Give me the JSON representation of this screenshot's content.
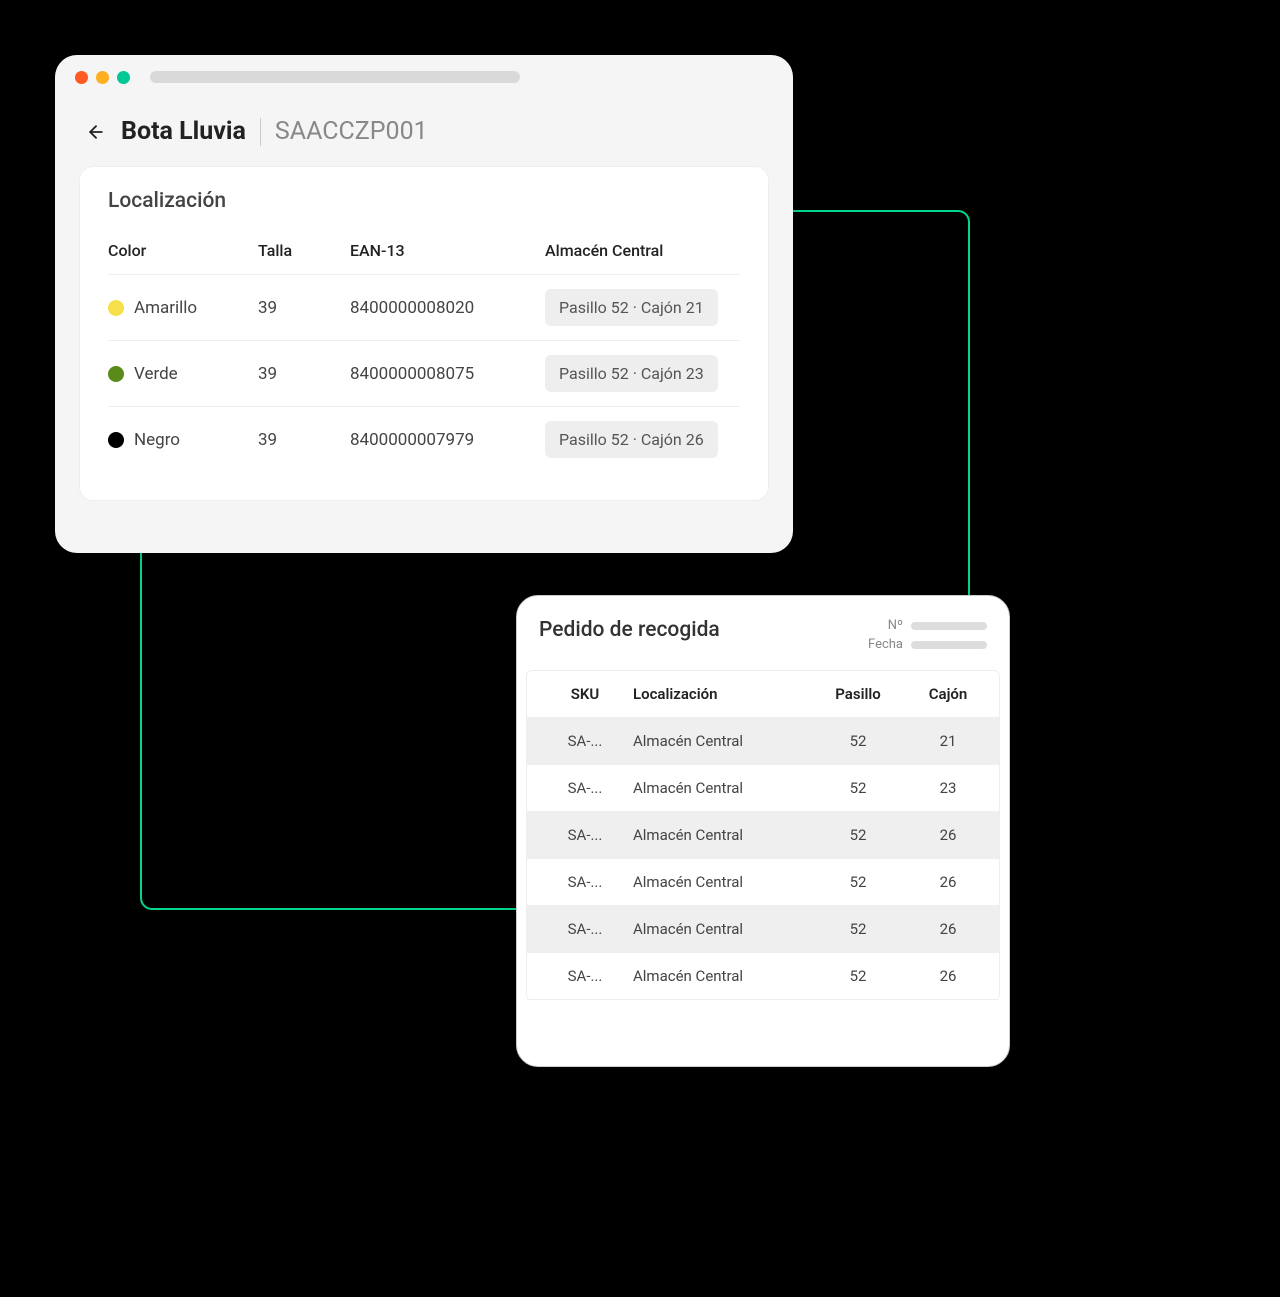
{
  "header": {
    "product_name": "Bota Lluvia",
    "product_code": "SAACCZP001"
  },
  "localization": {
    "title": "Localización",
    "columns": {
      "color": "Color",
      "size": "Talla",
      "ean": "EAN-13",
      "warehouse": "Almacén Central"
    },
    "rows": [
      {
        "color_name": "Amarillo",
        "color_hex": "#f5e04a",
        "size": "39",
        "ean": "8400000008020",
        "location_chip": "Pasillo 52  ·  Cajón 21"
      },
      {
        "color_name": "Verde",
        "color_hex": "#5a8a1a",
        "size": "39",
        "ean": "8400000008075",
        "location_chip": "Pasillo 52  ·  Cajón 23"
      },
      {
        "color_name": "Negro",
        "color_hex": "#000000",
        "size": "39",
        "ean": "8400000007979",
        "location_chip": "Pasillo 52  ·  Cajón 26"
      }
    ]
  },
  "picking": {
    "title": "Pedido de recogida",
    "meta": {
      "number_label": "Nº",
      "date_label": "Fecha"
    },
    "columns": {
      "sku": "SKU",
      "location": "Localización",
      "aisle": "Pasillo",
      "bin": "Cajón"
    },
    "rows": [
      {
        "sku": "SA-...",
        "location": "Almacén Central",
        "aisle": "52",
        "bin": "21"
      },
      {
        "sku": "SA-...",
        "location": "Almacén Central",
        "aisle": "52",
        "bin": "23"
      },
      {
        "sku": "SA-...",
        "location": "Almacén Central",
        "aisle": "52",
        "bin": "26"
      },
      {
        "sku": "SA-...",
        "location": "Almacén Central",
        "aisle": "52",
        "bin": "26"
      },
      {
        "sku": "SA-...",
        "location": "Almacén Central",
        "aisle": "52",
        "bin": "26"
      },
      {
        "sku": "SA-...",
        "location": "Almacén Central",
        "aisle": "52",
        "bin": "26"
      }
    ]
  }
}
